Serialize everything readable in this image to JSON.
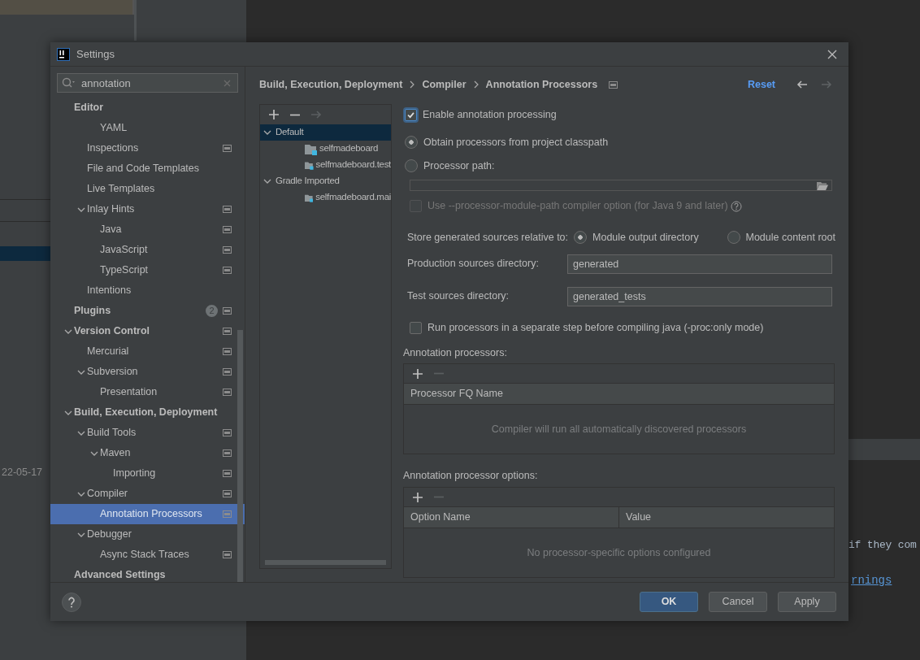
{
  "background": {
    "date_text": "22-05-17",
    "code_text": "if they com",
    "link_text": "rnings"
  },
  "dialog": {
    "title": "Settings"
  },
  "search": {
    "value": "annotation"
  },
  "tree": [
    {
      "label": "Editor",
      "children": [
        {
          "children": [
            {
              "label": "YAML",
              "selected": false
            }
          ]
        },
        {
          "label": "Inspections",
          "selected": false,
          "project_scope": true
        },
        {
          "label": "File and Code Templates",
          "selected": false
        },
        {
          "label": "Live Templates",
          "selected": false
        },
        {
          "label": "Inlay Hints",
          "expanded": true,
          "selected": false,
          "project_scope": true,
          "children": [
            {
              "label": "Java",
              "selected": false,
              "project_scope": true
            },
            {
              "label": "JavaScript",
              "selected": false,
              "project_scope": true
            },
            {
              "label": "TypeScript",
              "selected": false,
              "project_scope": true
            }
          ]
        },
        {
          "label": "Intentions",
          "selected": false
        }
      ],
      "selected": false
    },
    {
      "label": "Plugins",
      "badge": "2",
      "selected": false,
      "project_scope": true
    },
    {
      "label": "Version Control",
      "expanded": true,
      "selected": false,
      "project_scope": true,
      "children": [
        {
          "label": "Mercurial",
          "selected": false,
          "project_scope": true
        },
        {
          "label": "Subversion",
          "expanded": true,
          "selected": false,
          "project_scope": true,
          "children": [
            {
              "label": "Presentation",
              "selected": false,
              "project_scope": true
            }
          ]
        }
      ]
    },
    {
      "label": "Build, Execution, Deployment",
      "expanded": true,
      "selected": false,
      "children": [
        {
          "label": "Build Tools",
          "expanded": true,
          "selected": false,
          "project_scope": true,
          "children": [
            {
              "label": "Maven",
              "expanded": true,
              "selected": false,
              "project_scope": true,
              "children": [
                {
                  "label": "Importing",
                  "selected": false,
                  "project_scope": true
                }
              ]
            }
          ]
        },
        {
          "label": "Compiler",
          "expanded": true,
          "selected": false,
          "project_scope": true,
          "children": [
            {
              "label": "Annotation Processors",
              "selected": true,
              "project_scope": true
            }
          ]
        },
        {
          "label": "Debugger",
          "expanded": true,
          "selected": false,
          "children": [
            {
              "label": "Async Stack Traces",
              "selected": false,
              "project_scope": true
            }
          ]
        }
      ]
    },
    {
      "label": "Advanced Settings",
      "selected": false
    }
  ],
  "breadcrumb": {
    "items": [
      "Build, Execution, Deployment",
      "Compiler",
      "Annotation Processors"
    ],
    "project_scope": true
  },
  "reset_label": "Reset",
  "nav": [
    {
      "kind": "back",
      "disabled": false
    },
    {
      "kind": "forward",
      "disabled": true
    }
  ],
  "profiles": {
    "toolbar": [
      {
        "kind": "add",
        "disabled": false
      },
      {
        "kind": "remove",
        "disabled": false
      },
      {
        "kind": "move",
        "disabled": true
      }
    ],
    "tree": [
      {
        "label": "Default",
        "expanded": true,
        "selected": true,
        "children": [
          {
            "label": "selfmadeboard",
            "selected": false
          },
          {
            "label": "selfmadeboard.test",
            "selected": false
          }
        ]
      },
      {
        "label": "Gradle Imported",
        "expanded": true,
        "selected": false,
        "children": [
          {
            "label": "selfmadeboard.mai",
            "selected": false
          }
        ]
      }
    ]
  },
  "settings": {
    "enable": {
      "label": "Enable annotation processing",
      "checked": true
    },
    "source_options": [
      {
        "label": "Obtain processors from project classpath",
        "selected": true
      },
      {
        "label": "Processor path:",
        "selected": false
      }
    ],
    "processor_path": {
      "disabled": true
    },
    "module_path": {
      "label": "Use --processor-module-path compiler option (for Java 9 and later)",
      "checked": false,
      "disabled": true
    },
    "store_label": "Store generated sources relative to:",
    "store_options": [
      {
        "label": "Module output directory",
        "selected": true
      },
      {
        "label": "Module content root",
        "selected": false
      }
    ],
    "directories": [
      {
        "label": "Production sources directory:",
        "value": "generated"
      },
      {
        "label": "Test sources directory:",
        "value": "generated_tests"
      }
    ],
    "separate_step": {
      "label": "Run processors in a separate step before compiling java (-proc:only mode)",
      "checked": false,
      "disabled": false
    }
  },
  "tables": [
    {
      "title": "Annotation processors:",
      "toolbar": [
        {
          "kind": "add",
          "disabled": false
        },
        {
          "kind": "remove",
          "disabled": true
        }
      ],
      "columns": [
        "Processor FQ Name"
      ],
      "empty_text": "Compiler will run all automatically discovered processors"
    },
    {
      "title": "Annotation processor options:",
      "toolbar": [
        {
          "kind": "add",
          "disabled": false
        },
        {
          "kind": "remove",
          "disabled": true
        }
      ],
      "columns": [
        "Option Name",
        "Value"
      ],
      "empty_text": "No processor-specific options configured"
    }
  ],
  "footer": {
    "buttons": [
      {
        "label": "OK",
        "kind": "primary"
      },
      {
        "label": "Cancel",
        "kind": "default"
      },
      {
        "label": "Apply",
        "kind": "default"
      }
    ]
  }
}
